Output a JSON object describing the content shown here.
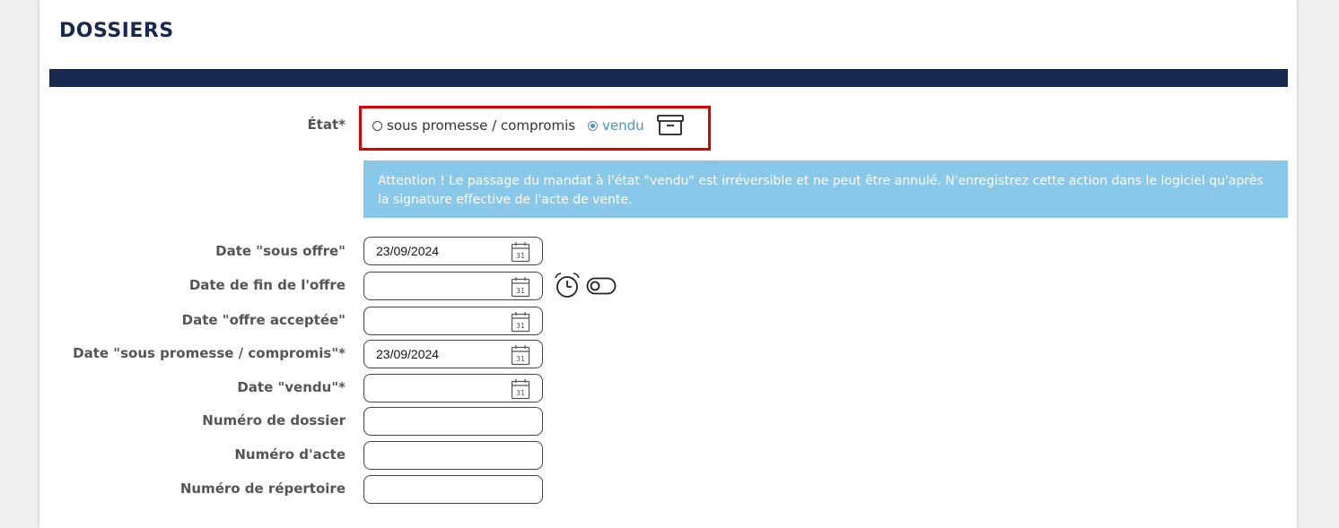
{
  "page": {
    "title": "DOSSIERS"
  },
  "etat": {
    "label": "État*",
    "options": [
      {
        "label": "sous promesse / compromis",
        "checked": false
      },
      {
        "label": "vendu",
        "checked": true
      }
    ],
    "archive_icon": "archive-box-icon"
  },
  "alert": {
    "text": "Attention ! Le passage du mandat à l'état \"vendu\" est irréversible et ne peut être annulé. N'enregistrez cette action dans le logiciel qu'après la signature effective de l'acte de vente."
  },
  "fields": [
    {
      "label": "Date \"sous offre\"",
      "value": "23/09/2024",
      "type": "date"
    },
    {
      "label": "Date de fin de l'offre",
      "value": "",
      "type": "date"
    },
    {
      "label": "Date \"offre acceptée\"",
      "value": "",
      "type": "date"
    },
    {
      "label": "Date \"sous promesse / compromis\"*",
      "value": "23/09/2024",
      "type": "date"
    },
    {
      "label": "Date \"vendu\"*",
      "value": "",
      "type": "date"
    },
    {
      "label": "Numéro de dossier",
      "value": "",
      "type": "text"
    },
    {
      "label": "Numéro d'acte",
      "value": "",
      "type": "text"
    },
    {
      "label": "Numéro de répertoire",
      "value": "",
      "type": "text"
    }
  ],
  "icons": {
    "calendar": "calendar-icon",
    "reminder": "alarm-clock-icon",
    "toggle": "toggle-switch-icon"
  },
  "colors": {
    "header_bar": "#17294e",
    "title": "#17294e",
    "alert_bg": "#89c8e8",
    "highlight_border": "#e00000",
    "radio_selected": "#4a90d9"
  }
}
